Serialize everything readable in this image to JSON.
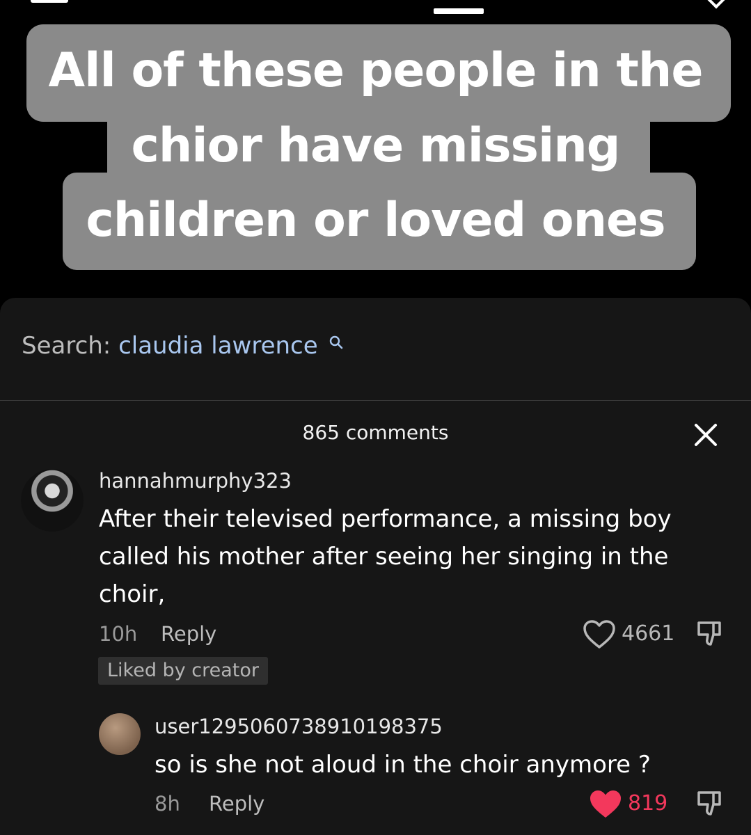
{
  "video": {
    "caption_lines": [
      "All of these people in the",
      "chior have missing",
      "children or loved ones"
    ]
  },
  "search": {
    "prefix": "Search:",
    "term": "claudia lawrence",
    "icon": "search-icon"
  },
  "comments_panel": {
    "count_label": "865 comments",
    "close_icon": "close-icon"
  },
  "comments": [
    {
      "username": "hannahmurphy323",
      "text_lines": [
        "After their televised performance, a missing boy",
        "called his mother after seeing her singing in the",
        "choir,"
      ],
      "time": "10h",
      "reply_label": "Reply",
      "badge": "Liked by creator",
      "likes": "4661",
      "liked": false
    },
    {
      "username": "user1295060738910198375",
      "text_lines": [
        "so is she not aloud in the choir anymore ?"
      ],
      "time": "8h",
      "reply_label": "Reply",
      "likes": "819",
      "liked": true
    }
  ],
  "colors": {
    "liked": "#f3385c",
    "search_term": "#a9c7ef",
    "caption_box": "#8a8a8a",
    "sheet": "#161616"
  }
}
